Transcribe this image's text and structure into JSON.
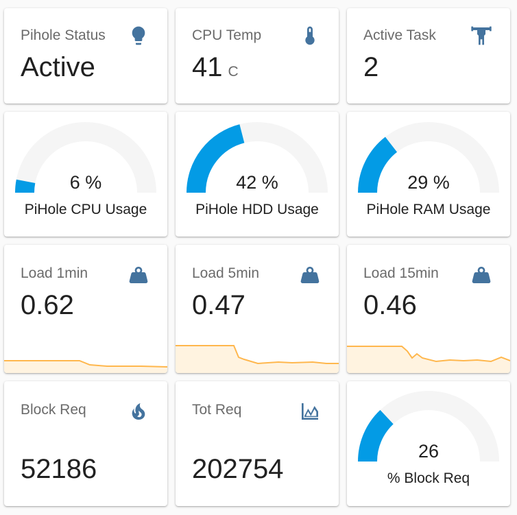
{
  "status": {
    "title": "Pihole Status",
    "value": "Active"
  },
  "cpu_temp": {
    "title": "CPU Temp",
    "value": "41",
    "unit": "C"
  },
  "active_task": {
    "title": "Active Task",
    "value": "2"
  },
  "gauges": [
    {
      "label": "PiHole CPU Usage",
      "value": "6 %",
      "percent": 6
    },
    {
      "label": "PiHole HDD Usage",
      "value": "42 %",
      "percent": 42
    },
    {
      "label": "PiHole RAM Usage",
      "value": "29 %",
      "percent": 29
    }
  ],
  "loads": [
    {
      "title": "Load 1min",
      "value": "0.62"
    },
    {
      "title": "Load 5min",
      "value": "0.47"
    },
    {
      "title": "Load 15min",
      "value": "0.46"
    }
  ],
  "block_req": {
    "title": "Block Req",
    "value": "52186"
  },
  "tot_req": {
    "title": "Tot Req",
    "value": "202754"
  },
  "block_pct": {
    "label": "% Block Req",
    "value": "26",
    "percent": 26
  },
  "colors": {
    "accent": "#039be5",
    "icon": "#44739e",
    "track": "#f5f5f5",
    "spark_line": "#ffb74d",
    "spark_fill": "#fff3e0"
  },
  "icons": {
    "status": "lightbulb-icon",
    "cpu_temp": "thermometer-icon",
    "active_task": "weightlifter-icon",
    "load": "weight-icon",
    "block_req": "fire-icon",
    "tot_req": "chart-line-icon"
  }
}
